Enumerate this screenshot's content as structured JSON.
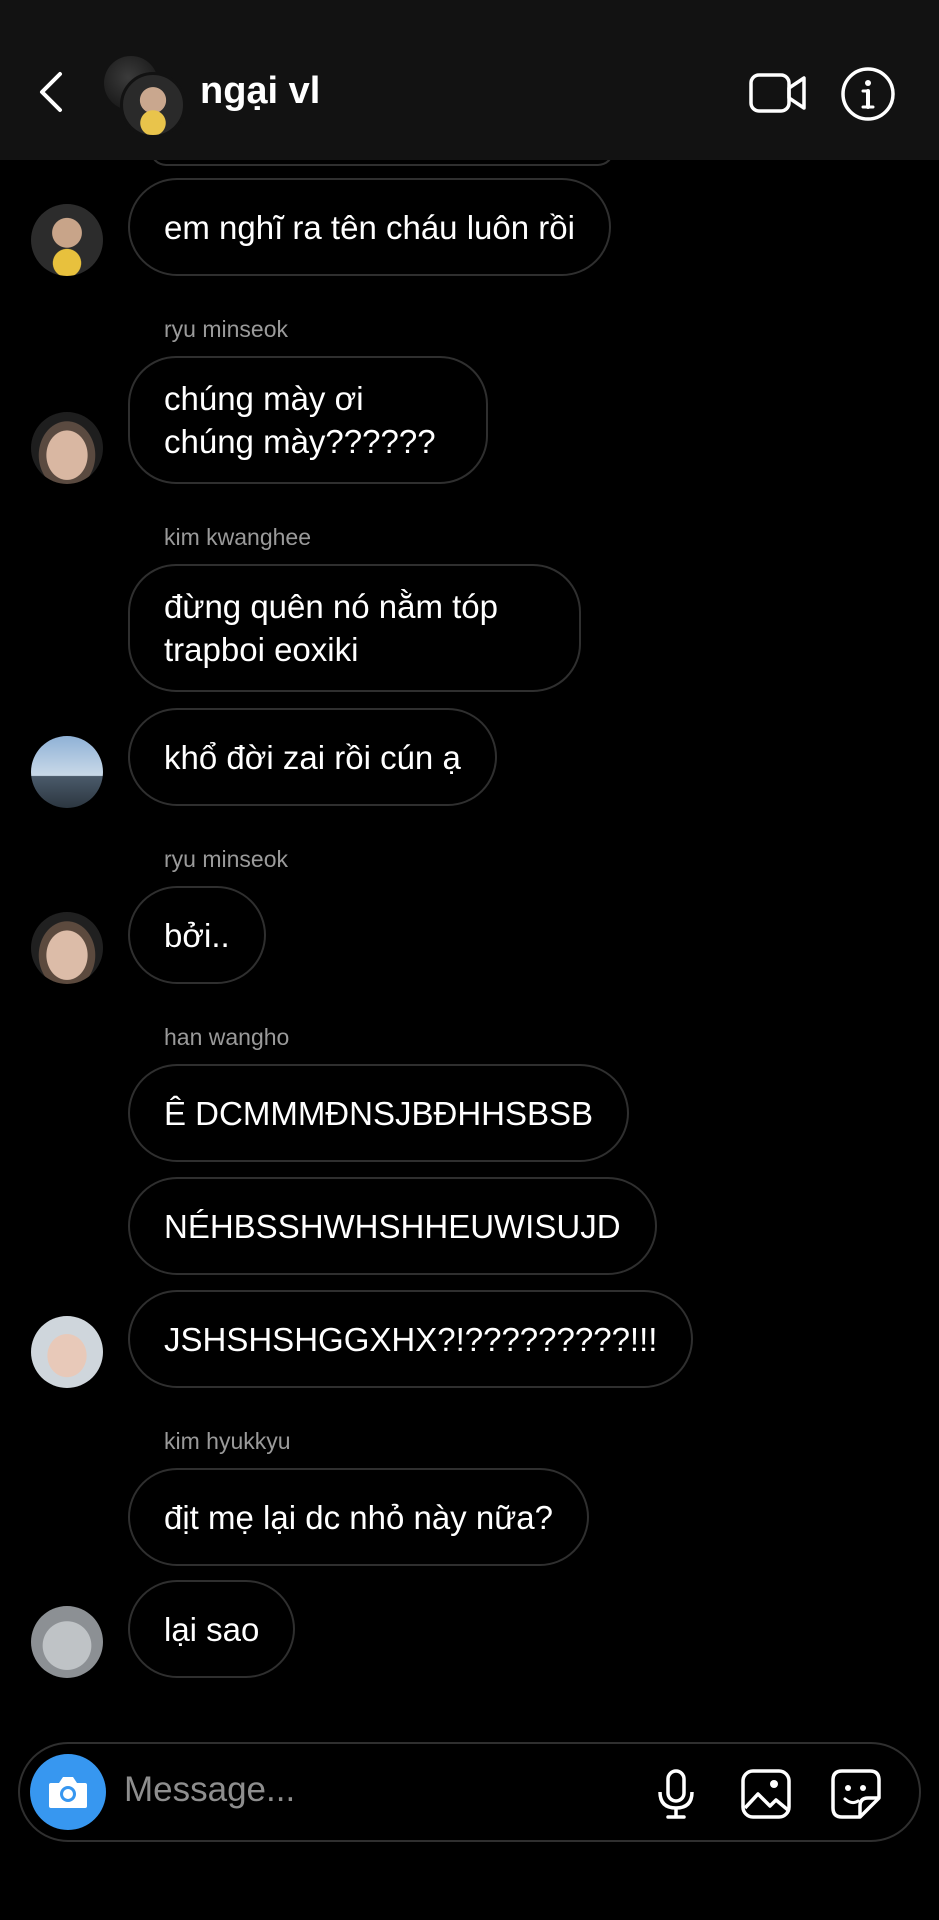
{
  "header": {
    "title": "ngại vl",
    "back_icon": "chevron-left-icon",
    "video_icon": "video-call-icon",
    "info_icon": "info-icon"
  },
  "messages": [
    {
      "sender": "",
      "text": "em nghĩ ra tên cháu luôn rồi",
      "avatar": "faker"
    },
    {
      "sender": "ryu minseok",
      "text": "chúng mày ơi\nchúng mày??????",
      "avatar": "ryu"
    },
    {
      "sender": "kim kwanghee",
      "text": "đừng quên nó nằm tóp\ntrapboi eoxiki",
      "avatar": ""
    },
    {
      "sender": "",
      "text": "khổ đời zai rồi cún ạ",
      "avatar": "kim"
    },
    {
      "sender": "ryu minseok",
      "text": "bởi..",
      "avatar": "ryu"
    },
    {
      "sender": "han wangho",
      "text": "Ê DCMMMĐNSJBĐHHSBSB",
      "avatar": ""
    },
    {
      "sender": "",
      "text": "NÉHBSSHWHSHHEUWISUJD",
      "avatar": ""
    },
    {
      "sender": "",
      "text": "JSHSHSHGGXHX?!?????????!!!",
      "avatar": "han"
    },
    {
      "sender": "kim hyukkyu",
      "text": "địt mẹ lại dc nhỏ này nữa?",
      "avatar": ""
    },
    {
      "sender": "",
      "text": "lại sao",
      "avatar": "hyukkyu"
    }
  ],
  "composer": {
    "placeholder": "Message...",
    "camera_icon": "camera-icon",
    "mic_icon": "microphone-icon",
    "gallery_icon": "gallery-icon",
    "sticker_icon": "sticker-icon",
    "accent": "#3797f0"
  },
  "colors": {
    "background": "#000000",
    "header": "#121212",
    "bubble_border": "#2f2f2f",
    "sender_label": "#9a9a9a"
  }
}
